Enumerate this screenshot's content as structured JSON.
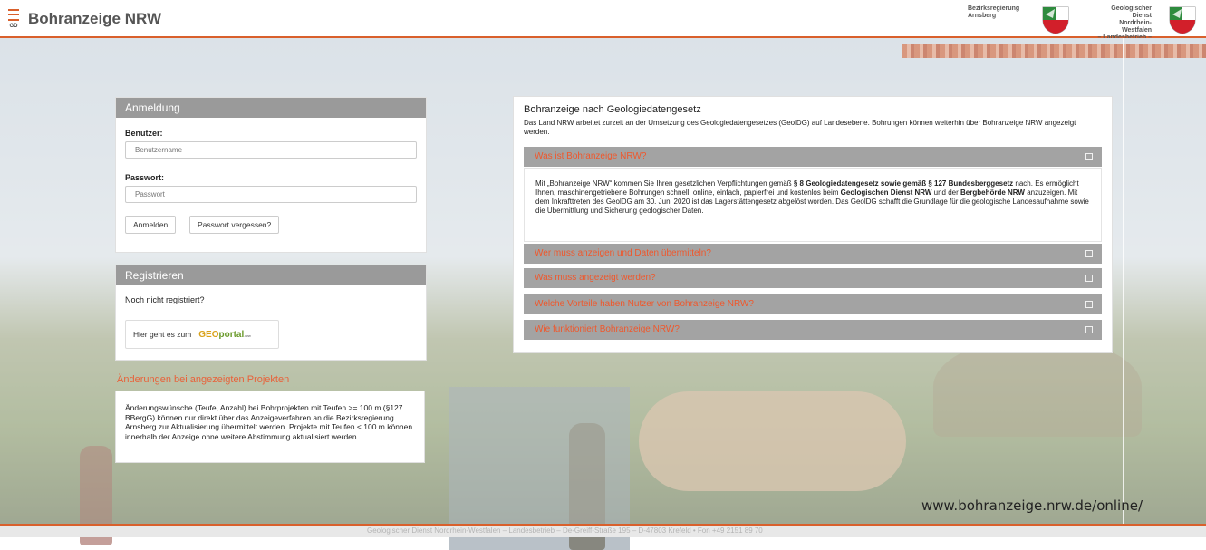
{
  "header": {
    "logo_text": "GD",
    "title": "Bohranzeige NRW",
    "authority1": [
      "Bezirksregierung",
      "Arnsberg"
    ],
    "authority2": [
      "Geologischer Dienst",
      "Nordrhein-Westfalen",
      "– Landesbetrieb –"
    ]
  },
  "login": {
    "heading": "Anmeldung",
    "user_label": "Benutzer:",
    "user_placeholder": "Benutzername",
    "password_label": "Passwort:",
    "password_placeholder": "Passwort",
    "login_button": "Anmelden",
    "forgot_button": "Passwort vergessen?"
  },
  "register": {
    "heading": "Registrieren",
    "question": "Noch nicht registriert?",
    "link_text": "Hier geht es zum",
    "geo_logo_prefix": "GEO",
    "geo_logo_main": "portal",
    "geo_logo_suffix": ".nrw"
  },
  "changes": {
    "title": "Änderungen bei angezeigten Projekten",
    "text": "Änderungswünsche (Teufe, Anzahl) bei Bohrprojekten mit Teufen >= 100 m (§127 BBergG) können nur direkt über das Anzeigeverfahren an die Bezirksregierung Arnsberg zur Aktualisierung übermittelt werden. Projekte mit Teufen < 100 m können innerhalb der Anzeige ohne weitere Abstimmung aktualisiert werden."
  },
  "info": {
    "title": "Bohranzeige nach Geologiedatengesetz",
    "intro": "Das Land NRW arbeitet zurzeit an der Umsetzung des Geologiedatengesetzes (GeolDG) auf Landesebene. Bohrungen können weiterhin über Bohranzeige NRW angezeigt werden.",
    "accordion": [
      {
        "label": "Was ist Bohranzeige NRW?"
      },
      {
        "label": "Wer muss anzeigen und Daten übermitteln?"
      },
      {
        "label": "Was muss angezeigt werden?"
      },
      {
        "label": "Welche Vorteile haben Nutzer von Bohranzeige NRW?"
      },
      {
        "label": "Wie funktioniert Bohranzeige NRW?"
      }
    ],
    "body": {
      "p1": "Mit „Bohranzeige NRW“ kommen Sie Ihren gesetzlichen Verpflichtungen gemäß ",
      "b1": "§ 8 Geologiedatengesetz sowie gemäß § 127 Bundesberggesetz",
      "p2": " nach. Es ermöglicht Ihnen, maschinengetriebene Bohrungen schnell, online, einfach, papierfrei und kostenlos beim ",
      "b2": "Geologischen Dienst NRW",
      "p3": " und der ",
      "b3": "Bergbehörde NRW",
      "p4": " anzuzeigen. Mit dem Inkrafttreten des GeolDG am 30. Juni 2020 ist das Lagerstättengesetz abgelöst worden. Das GeolDG schafft die Grundlage für die geologische Landesaufnahme sowie die Übermittlung und Sicherung geologischer Daten."
    }
  },
  "url": "www.bohranzeige.nrw.de/online/",
  "footer": "Geologischer Dienst Nordrhein-Westfalen – Landesbetrieb – De-Greiff-Straße 195 – D-47803 Krefeld • Fon +49 2151 89 70",
  "colors": {
    "accent": "#d9602c",
    "link": "#f0572b",
    "panel_head": "#9a9a9a"
  }
}
